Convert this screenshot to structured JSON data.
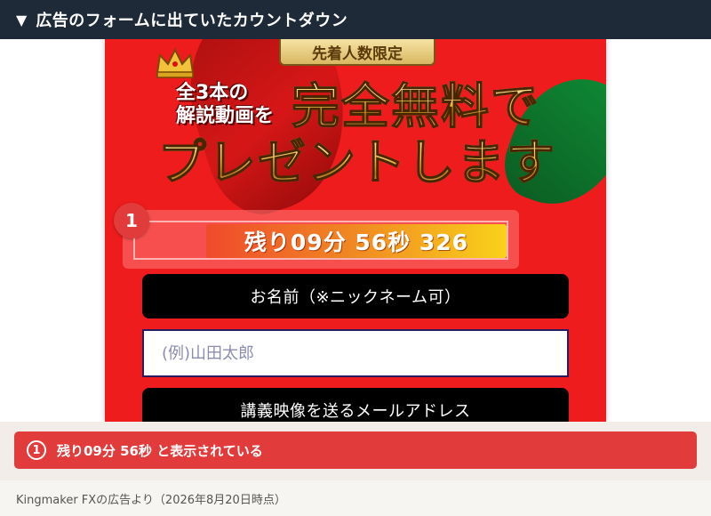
{
  "header": {
    "toggle_icon": "triangle-down-icon",
    "title": "広告のフォームに出ていたカウントダウン"
  },
  "ad": {
    "badge": "先着人数限定",
    "sub_line1": "全3本の",
    "sub_line2": "解説動画を",
    "headline1": "完全無料で",
    "headline2": "プレゼントします",
    "countdown": "残り09分 56秒 326",
    "marker": "1",
    "name_label": "お名前（※ニックネーム可）",
    "name_placeholder": "(例)山田太郎",
    "email_label": "講義映像を送るメールアドレス"
  },
  "callout": {
    "number": "1",
    "text": "残り09分 56秒 と表示されている"
  },
  "footer": {
    "text": "Kingmaker FXの広告より（2026年8月20日時点）"
  },
  "colors": {
    "header_bg": "#1e2a38",
    "ad_red": "#ee1c1c",
    "callout_red": "#e23b3b",
    "button_black": "#000000"
  }
}
